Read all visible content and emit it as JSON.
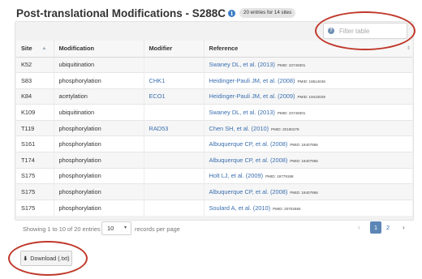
{
  "header": {
    "title": "Post-translational Modifications - S288C",
    "info_icon": "i",
    "badge": "20 entries for 14 sites"
  },
  "filter": {
    "placeholder": "Filter table",
    "icon": "?"
  },
  "table": {
    "columns": [
      "Site",
      "Modification",
      "Modifier",
      "Reference"
    ],
    "rows": [
      {
        "site": "K52",
        "modification": "ubiquitination",
        "modifier": "",
        "reference": "Swaney DL, et al. (2013)",
        "pmid": "PMID: 23749301"
      },
      {
        "site": "S83",
        "modification": "phosphorylation",
        "modifier": "CHK1",
        "reference": "Heidinger-Pauli JM, et al. (2008)",
        "pmid": "PMID: 18614046"
      },
      {
        "site": "K84",
        "modification": "acetylation",
        "modifier": "ECO1",
        "reference": "Heidinger-Pauli JM, et al. (2009)",
        "pmid": "PMID: 19410029"
      },
      {
        "site": "K109",
        "modification": "ubiquitination",
        "modifier": "",
        "reference": "Swaney DL, et al. (2013)",
        "pmid": "PMID: 23749301"
      },
      {
        "site": "T119",
        "modification": "phosphorylation",
        "modifier": "RAD53",
        "reference": "Chen SH, et al. (2010)",
        "pmid": "PMID: 20190278"
      },
      {
        "site": "S161",
        "modification": "phosphorylation",
        "modifier": "",
        "reference": "Albuquerque CP, et al. (2008)",
        "pmid": "PMID: 18407956"
      },
      {
        "site": "T174",
        "modification": "phosphorylation",
        "modifier": "",
        "reference": "Albuquerque CP, et al. (2008)",
        "pmid": "PMID: 18407956"
      },
      {
        "site": "S175",
        "modification": "phosphorylation",
        "modifier": "",
        "reference": "Holt LJ, et al. (2009)",
        "pmid": "PMID: 19779198"
      },
      {
        "site": "S175",
        "modification": "phosphorylation",
        "modifier": "",
        "reference": "Albuquerque CP, et al. (2008)",
        "pmid": "PMID: 18407956"
      },
      {
        "site": "S175",
        "modification": "phosphorylation",
        "modifier": "",
        "reference": "Soulard A, et al. (2010)",
        "pmid": "PMID: 20702584"
      }
    ]
  },
  "footer": {
    "showing": "Showing 1 to 10 of 20 entries",
    "page_size": "10",
    "per_page": "records per page",
    "prev": "‹",
    "current_page": "1",
    "next_page": "2",
    "next": "›"
  },
  "download": {
    "icon": "⬇",
    "label": "Download (.txt)"
  },
  "colors": {
    "link": "#3a6fb0",
    "active_page": "#5b86b6",
    "annotation": "#c0392b"
  }
}
